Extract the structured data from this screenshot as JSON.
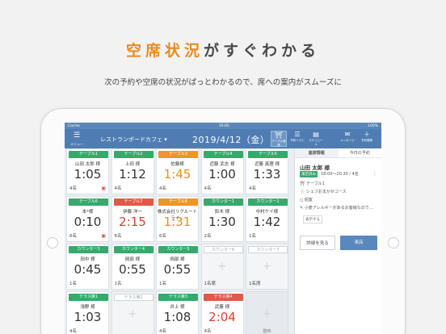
{
  "headline": {
    "highlight": "空席状況",
    "rest": "がすぐわかる"
  },
  "subline": "次の予約や空席の状況がぱっとわかるので、席への案内がスムーズに",
  "statusbar": {
    "carrier": "Carrier",
    "time": "19:05",
    "battery": "100%"
  },
  "topbar": {
    "menu_sub": "メニュー",
    "shop_name": "レストランボードカフェ ▾",
    "date": "2019/4/12（金）",
    "tools": [
      {
        "icon": "table-icon",
        "label": "テーブル管理"
      },
      {
        "icon": "list-icon",
        "label": "予約リスト"
      },
      {
        "icon": "schedule-icon",
        "label": "スケジュール"
      },
      {
        "icon": "message-icon",
        "label": "メッセージ"
      },
      {
        "icon": "plus-icon",
        "label": "予約登録"
      }
    ]
  },
  "tables": [
    {
      "badge": "テーブル1",
      "color": "green",
      "name": "山田 太郎 様",
      "time": "1:05",
      "time_color": "",
      "guests": "4名",
      "icon": "ok"
    },
    {
      "badge": "テーブル2",
      "color": "green",
      "name": "上田 様",
      "time": "1:12",
      "time_color": "",
      "guests": "4名",
      "icon": ""
    },
    {
      "badge": "テーブル3",
      "color": "orange",
      "name": "佐藤様",
      "time": "1:45",
      "time_color": "orange",
      "guests": "4名",
      "icon": ""
    },
    {
      "badge": "テーブル4",
      "color": "green",
      "name": "近藤 武志 様",
      "time": "1:00",
      "time_color": "",
      "guests": "4名",
      "icon": ""
    },
    {
      "badge": "テーブル5",
      "color": "green",
      "name": "近藤 真理 様",
      "time": "1:33",
      "time_color": "",
      "guests": "4名",
      "icon": ""
    },
    {
      "badge": "テーブル6",
      "color": "green",
      "name": "本*様",
      "time": "0:10",
      "time_color": "",
      "guests": "6名",
      "icon": "ok"
    },
    {
      "badge": "テーブル7",
      "color": "red",
      "name": "伊藤 洋一",
      "time": "2:15",
      "time_color": "red",
      "guests": "6名",
      "icon": ""
    },
    {
      "badge": "テーブル8",
      "color": "orange",
      "name": "株式会社リクルートライ…",
      "time": "1:31",
      "time_color": "orange",
      "guests": "6名",
      "icon": ""
    },
    {
      "badge": "カウンター1",
      "color": "green",
      "name": "鈴木 様",
      "time": "1:30",
      "time_color": "",
      "guests": "2名",
      "icon": ""
    },
    {
      "badge": "カウンター2",
      "color": "green",
      "name": "中村ケイ様",
      "time": "1:42",
      "time_color": "",
      "guests": "1名",
      "icon": ""
    },
    {
      "badge": "カウンター3",
      "color": "green",
      "name": "田中 様",
      "time": "0:45",
      "time_color": "",
      "guests": "1名",
      "icon": ""
    },
    {
      "badge": "カウンター4",
      "color": "green",
      "name": "岡部 様",
      "time": "0:55",
      "time_color": "",
      "guests": "1名",
      "icon": ""
    },
    {
      "badge": "カウンター5",
      "color": "green",
      "name": "岡部 様",
      "time": "0:55",
      "time_color": "",
      "guests": "1名",
      "icon": ""
    },
    {
      "badge": "カウンター6",
      "color": "gray",
      "name": "",
      "time": "",
      "time_color": "",
      "guests": "1名席",
      "icon": ""
    },
    {
      "badge": "カウンター7",
      "color": "gray",
      "name": "",
      "time": "",
      "time_color": "",
      "guests": "1名席",
      "icon": ""
    },
    {
      "badge": "テラス席1",
      "color": "green",
      "name": "浅野 様",
      "time": "1:03",
      "time_color": "",
      "guests": "4名",
      "icon": ""
    },
    {
      "badge": "テラス席2",
      "color": "gray",
      "name": "",
      "time": "",
      "time_color": "",
      "guests": "",
      "icon": ""
    },
    {
      "badge": "テラス席3",
      "color": "green",
      "name": "井上 様",
      "time": "1:08",
      "time_color": "",
      "guests": "4名",
      "icon": ""
    },
    {
      "badge": "テラス席4",
      "color": "red",
      "name": "武藤 様",
      "time": "2:04",
      "time_color": "red",
      "guests": "4名",
      "icon": ""
    },
    {
      "badge": "",
      "color": "add",
      "name": "",
      "time": "",
      "time_color": "",
      "guests": "",
      "icon": "",
      "add_label": "臨時"
    }
  ],
  "panel": {
    "tabs": [
      "座席情報",
      "今日の予約"
    ],
    "name": "山田 太郎 様",
    "status": "来店済み",
    "time": "18:00〜20:30 / 4名",
    "table": "テーブル1",
    "course": "シェフおまかせコース",
    "seat": "個室",
    "note": "小麦アレルギーがあるお客様なので…",
    "notice": "表示する",
    "btn_detail": "詳細を見る",
    "btn_visit": "来店"
  }
}
